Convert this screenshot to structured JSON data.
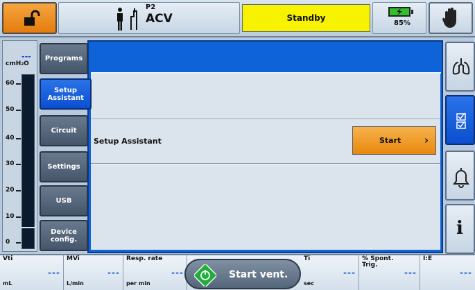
{
  "header": {
    "patient_id": "P2",
    "mode": "ACV",
    "status": "Standby",
    "battery_percent": "85%",
    "battery_level": 0.85
  },
  "pressure_scale": {
    "current_value": "---",
    "unit": "cmH₂O",
    "ticks": [
      "60",
      "50",
      "40",
      "30",
      "20",
      "10",
      "0"
    ]
  },
  "nav": {
    "items": [
      {
        "label": "Programs"
      },
      {
        "label": "Setup Assistant",
        "active": true
      },
      {
        "label": "Circuit"
      },
      {
        "label": "Settings"
      },
      {
        "label": "USB"
      },
      {
        "label": "Device config."
      }
    ]
  },
  "main": {
    "row_label": "Setup Assistant",
    "start_label": "Start",
    "start_chevron": "›"
  },
  "side": {
    "items": [
      {
        "icon": "lungs-icon"
      },
      {
        "icon": "checklist-icon",
        "active": true
      },
      {
        "icon": "bell-icon"
      },
      {
        "icon": "info-icon",
        "glyph": "i"
      }
    ]
  },
  "params": {
    "vti": {
      "name": "Vti",
      "unit": "mL",
      "value": "---"
    },
    "mvi": {
      "name": "MVi",
      "unit": "L/min",
      "value": "---"
    },
    "rr": {
      "name": "Resp. rate",
      "unit": "per min",
      "value": "---"
    },
    "ti": {
      "name": "Ti",
      "unit": "sec",
      "value": "---"
    },
    "spont": {
      "name": "% Spont. Trig.",
      "unit": "",
      "value": "---"
    },
    "ie": {
      "name": "I:E",
      "unit": "",
      "value": "---"
    }
  },
  "start_vent": {
    "label": "Start vent."
  },
  "colors": {
    "accent": "#0f63d8",
    "status_bg": "#f6f200",
    "action_orange": "#f0a030",
    "value_blue": "#1a55d8"
  }
}
